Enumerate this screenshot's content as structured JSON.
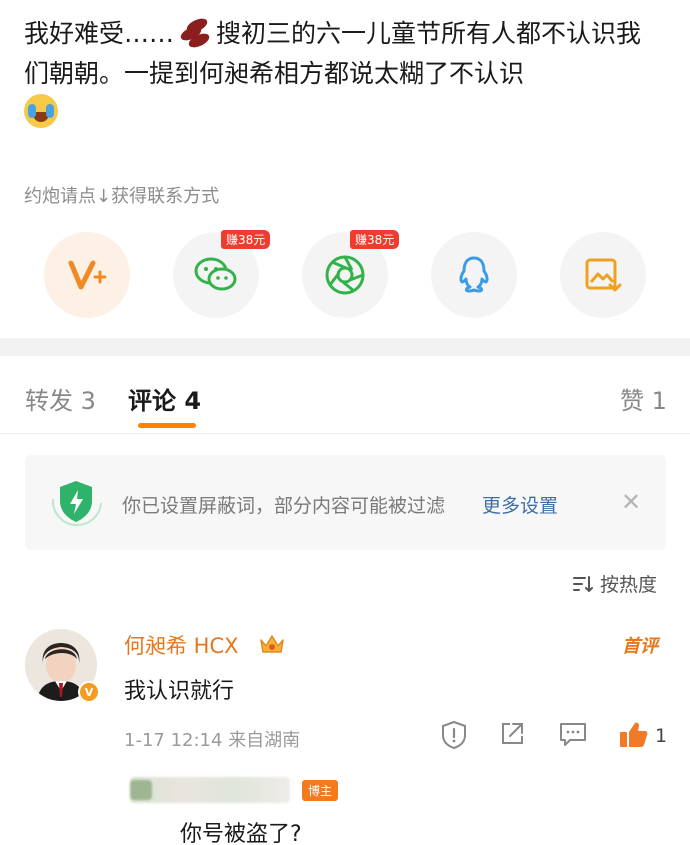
{
  "post": {
    "text_part1": "我好难受……",
    "text_part2": "搜初三的六一儿童节所有人都不认识我们朝朝。一提到何昶希相方都说太糊了不认识"
  },
  "hint": "约炮请点↓获得联系方式",
  "share": {
    "wechat_badge": "赚38元",
    "moments_badge": "赚38元"
  },
  "tabs": {
    "repost_label": "转发",
    "repost_count": "3",
    "comment_label": "评论",
    "comment_count": "4",
    "like_label": "赞",
    "like_count": "1"
  },
  "filter_notice": {
    "text": "你已设置屏蔽词，部分内容可能被过滤",
    "link": "更多设置",
    "close": "✕"
  },
  "sort": {
    "label": "按热度"
  },
  "comment": {
    "author": "何昶希 HCX",
    "first_badge": "首评",
    "text": "我认识就行",
    "time": "1-17 12:14",
    "location": "来自湖南",
    "like_count": "1"
  },
  "reply": {
    "host_badge": "博主",
    "text": "你号被盗了?"
  },
  "colors": {
    "accent": "#ff8200",
    "name": "#e8761a",
    "link": "#3f6ea8",
    "red_badge": "#f03c2e"
  }
}
